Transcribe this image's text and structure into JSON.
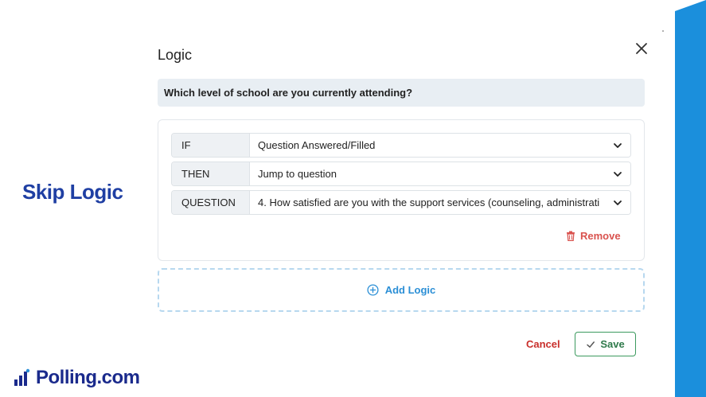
{
  "side_title": "Skip Logic",
  "brand": {
    "name": "Polling.com"
  },
  "modal": {
    "title": "Logic",
    "question": "Which level of school are you currently attending?",
    "rows": [
      {
        "label": "IF",
        "value": "Question Answered/Filled"
      },
      {
        "label": "THEN",
        "value": "Jump to question"
      },
      {
        "label": "QUESTION",
        "value": "4. How satisfied are you with the support services (counseling, administrati"
      }
    ],
    "remove_label": "Remove",
    "add_logic_label": "Add Logic",
    "cancel_label": "Cancel",
    "save_label": "Save"
  },
  "colors": {
    "accent_blue": "#2b8fd6",
    "brand_navy": "#1a2a8c",
    "side_stripe": "#1b8fdc",
    "remove_red": "#d9534f",
    "save_green": "#3c9a5f"
  },
  "icons": [
    "close-icon",
    "chevron-down-icon",
    "trash-icon",
    "plus-circle-icon",
    "check-icon",
    "polling-logo-icon"
  ]
}
